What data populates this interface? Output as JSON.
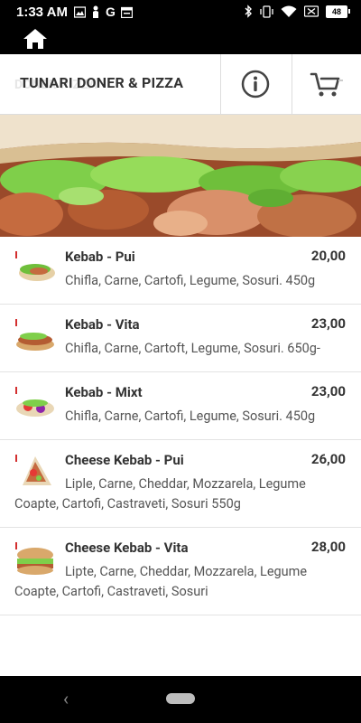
{
  "status": {
    "time": "1:33 AM",
    "battery": "48"
  },
  "header": {
    "title": "TUNARI DONER & PIZZA",
    "title_shadow": "DONER PIZZA"
  },
  "items": [
    {
      "name": "Kebab - Pui",
      "price": "20,00",
      "desc": "Chifla, Carne, Cartofi, Legume, Sosuri. 450g"
    },
    {
      "name": "Kebab - Vita",
      "price": "23,00",
      "desc": "Chifla, Carne, Cartoft, Legume, Sosuri. 650g-"
    },
    {
      "name": "Kebab - Mixt",
      "price": "23,00",
      "desc": "Chifla, Carne, Cartofi, Legume, Sosuri. 450g"
    },
    {
      "name": "Cheese Kebab - Pui",
      "price": "26,00",
      "desc": "Liple, Carne, Cheddar, Mozzarela, Legume Coapte, Cartofi, Castraveti, Sosuri 550g"
    },
    {
      "name": "Cheese Kebab - Vita",
      "price": "28,00",
      "desc": "Lipte, Carne, Cheddar, Mozzarela, Legume Coapte, Cartofi, Castraveti, Sosuri"
    }
  ],
  "icons": {
    "home": "home-icon",
    "info": "info-icon",
    "cart": "cart-icon",
    "back": "back-icon",
    "nav_home": "home-pill"
  }
}
